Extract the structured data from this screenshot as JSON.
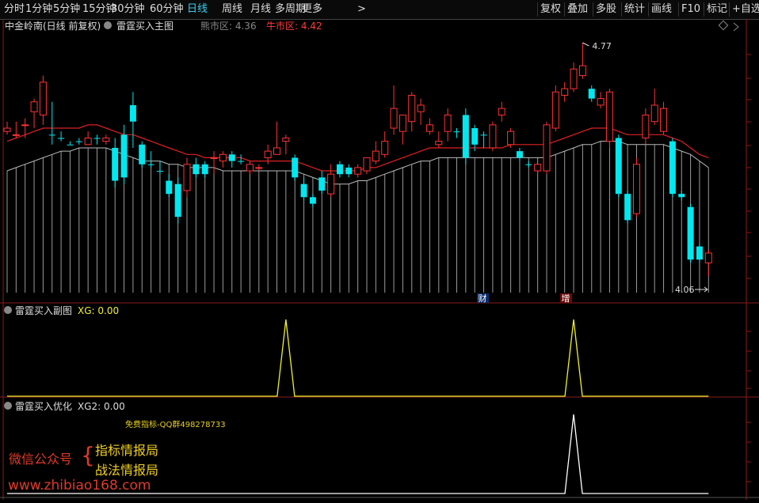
{
  "toolbar": {
    "periods": [
      "分时",
      "1分钟",
      "5分钟",
      "15分钟",
      "30分钟",
      "60分钟",
      "日线",
      "周线",
      "月线",
      "多周期",
      "更多"
    ],
    "active_period": "日线",
    "more_arrow": ">",
    "right_buttons": [
      "复权",
      "叠加",
      "多股",
      "统计",
      "画线",
      "F10",
      "标记",
      "+自选"
    ]
  },
  "main_pane": {
    "stock_title": "中金岭南(日线 前复权)",
    "indicator_name": "雷霆买入主图",
    "bear_label": "熊市区: 4.36",
    "bull_label": "牛市区: 4.42",
    "high_label": "4.77",
    "low_label": "4.06",
    "event_markers": [
      "财",
      "增"
    ]
  },
  "sub_pane1": {
    "name": "雷霆买入副图",
    "value_label": "XG: 0.00"
  },
  "sub_pane2": {
    "name": "雷霆买入优化",
    "value_label": "XG2: 0.00",
    "promo_text": "免费指标-QQ群498278733"
  },
  "watermark": {
    "account_label": "微信公众号",
    "brace": "{",
    "line1": "指标情报局",
    "line2": "战法情报局",
    "url": "www.zhibiao168.com"
  },
  "colors": {
    "up": "#ff3333",
    "down": "#00e8f0",
    "ma_red": "#e02020",
    "ma_gray": "#bbbbbb",
    "signal": "#f0f030",
    "active": "#38d0f0"
  },
  "chart_data": {
    "type": "candlestick",
    "price_high": 4.77,
    "price_low": 4.06,
    "candles": [
      {
        "o": 4.5,
        "c": 4.51,
        "h": 4.53,
        "l": 4.49,
        "up": true
      },
      {
        "o": 4.49,
        "c": 4.49,
        "h": 4.53,
        "l": 4.48,
        "up": true
      },
      {
        "o": 4.52,
        "c": 4.52,
        "h": 4.54,
        "l": 4.48,
        "up": true
      },
      {
        "o": 4.56,
        "c": 4.59,
        "h": 4.6,
        "l": 4.51,
        "up": true
      },
      {
        "o": 4.55,
        "c": 4.65,
        "h": 4.67,
        "l": 4.52,
        "up": true
      },
      {
        "o": 4.49,
        "c": 4.49,
        "h": 4.59,
        "l": 4.46,
        "up": false
      },
      {
        "o": 4.48,
        "c": 4.48,
        "h": 4.5,
        "l": 4.47,
        "up": false
      },
      {
        "o": 4.46,
        "c": 4.46,
        "h": 4.47,
        "l": 4.46,
        "up": false
      },
      {
        "o": 4.47,
        "c": 4.47,
        "h": 4.48,
        "l": 4.46,
        "up": false
      },
      {
        "o": 4.46,
        "c": 4.48,
        "h": 4.5,
        "l": 4.46,
        "up": true
      },
      {
        "o": 4.48,
        "c": 4.48,
        "h": 4.49,
        "l": 4.46,
        "up": false
      },
      {
        "o": 4.47,
        "c": 4.48,
        "h": 4.49,
        "l": 4.46,
        "up": true
      },
      {
        "o": 4.45,
        "c": 4.35,
        "h": 4.48,
        "l": 4.33,
        "up": false
      },
      {
        "o": 4.49,
        "c": 4.36,
        "h": 4.52,
        "l": 4.34,
        "up": false
      },
      {
        "o": 4.53,
        "c": 4.58,
        "h": 4.62,
        "l": 4.45,
        "up": false
      },
      {
        "o": 4.46,
        "c": 4.4,
        "h": 4.47,
        "l": 4.39,
        "up": false
      },
      {
        "o": 4.4,
        "c": 4.4,
        "h": 4.44,
        "l": 4.39,
        "up": false
      },
      {
        "o": 4.38,
        "c": 4.38,
        "h": 4.41,
        "l": 4.37,
        "up": false
      },
      {
        "o": 4.35,
        "c": 4.31,
        "h": 4.37,
        "l": 4.3,
        "up": false
      },
      {
        "o": 4.34,
        "c": 4.24,
        "h": 4.36,
        "l": 4.22,
        "up": false
      },
      {
        "o": 4.32,
        "c": 4.4,
        "h": 4.42,
        "l": 4.3,
        "up": true
      },
      {
        "o": 4.4,
        "c": 4.37,
        "h": 4.42,
        "l": 4.36,
        "up": false
      },
      {
        "o": 4.4,
        "c": 4.37,
        "h": 4.41,
        "l": 4.36,
        "up": false
      },
      {
        "o": 4.42,
        "c": 4.42,
        "h": 4.44,
        "l": 4.37,
        "up": true
      },
      {
        "o": 4.41,
        "c": 4.43,
        "h": 4.44,
        "l": 4.39,
        "up": true
      },
      {
        "o": 4.43,
        "c": 4.41,
        "h": 4.44,
        "l": 4.39,
        "up": false
      },
      {
        "o": 4.41,
        "c": 4.41,
        "h": 4.43,
        "l": 4.4,
        "up": false
      },
      {
        "o": 4.4,
        "c": 4.38,
        "h": 4.41,
        "l": 4.37,
        "up": true
      },
      {
        "o": 4.39,
        "c": 4.39,
        "h": 4.4,
        "l": 4.38,
        "up": true
      },
      {
        "o": 4.42,
        "c": 4.44,
        "h": 4.46,
        "l": 4.4,
        "up": true
      },
      {
        "o": 4.43,
        "c": 4.45,
        "h": 4.53,
        "l": 4.43,
        "up": true
      },
      {
        "o": 4.47,
        "c": 4.48,
        "h": 4.49,
        "l": 4.43,
        "up": true
      },
      {
        "o": 4.42,
        "c": 4.36,
        "h": 4.43,
        "l": 4.35,
        "up": false
      },
      {
        "o": 4.34,
        "c": 4.3,
        "h": 4.36,
        "l": 4.29,
        "up": false
      },
      {
        "o": 4.3,
        "c": 4.28,
        "h": 4.31,
        "l": 4.27,
        "up": false
      },
      {
        "o": 4.36,
        "c": 4.32,
        "h": 4.38,
        "l": 4.31,
        "up": false
      },
      {
        "o": 4.31,
        "c": 4.37,
        "h": 4.4,
        "l": 4.3,
        "up": true
      },
      {
        "o": 4.4,
        "c": 4.37,
        "h": 4.41,
        "l": 4.36,
        "up": false
      },
      {
        "o": 4.39,
        "c": 4.37,
        "h": 4.4,
        "l": 4.36,
        "up": false
      },
      {
        "o": 4.37,
        "c": 4.39,
        "h": 4.4,
        "l": 4.36,
        "up": true
      },
      {
        "o": 4.38,
        "c": 4.42,
        "h": 4.42,
        "l": 4.37,
        "up": true
      },
      {
        "o": 4.41,
        "c": 4.44,
        "h": 4.47,
        "l": 4.4,
        "up": true
      },
      {
        "o": 4.43,
        "c": 4.47,
        "h": 4.5,
        "l": 4.42,
        "up": true
      },
      {
        "o": 4.51,
        "c": 4.57,
        "h": 4.64,
        "l": 4.49,
        "up": true
      },
      {
        "o": 4.55,
        "c": 4.5,
        "h": 4.55,
        "l": 4.46,
        "up": true
      },
      {
        "o": 4.53,
        "c": 4.61,
        "h": 4.62,
        "l": 4.5,
        "up": true
      },
      {
        "o": 4.56,
        "c": 4.58,
        "h": 4.6,
        "l": 4.52,
        "up": true
      },
      {
        "o": 4.52,
        "c": 4.5,
        "h": 4.54,
        "l": 4.49,
        "up": true
      },
      {
        "o": 4.47,
        "c": 4.46,
        "h": 4.5,
        "l": 4.45,
        "up": true
      },
      {
        "o": 4.5,
        "c": 4.55,
        "h": 4.57,
        "l": 4.47,
        "up": true
      },
      {
        "o": 4.5,
        "c": 4.5,
        "h": 4.51,
        "l": 4.48,
        "up": false
      },
      {
        "o": 4.55,
        "c": 4.42,
        "h": 4.57,
        "l": 4.4,
        "up": false
      },
      {
        "o": 4.51,
        "c": 4.46,
        "h": 4.52,
        "l": 4.44,
        "up": false
      },
      {
        "o": 4.49,
        "c": 4.49,
        "h": 4.5,
        "l": 4.45,
        "up": false
      },
      {
        "o": 4.45,
        "c": 4.52,
        "h": 4.53,
        "l": 4.44,
        "up": true
      },
      {
        "o": 4.55,
        "c": 4.57,
        "h": 4.59,
        "l": 4.53,
        "up": true
      },
      {
        "o": 4.5,
        "c": 4.46,
        "h": 4.51,
        "l": 4.45,
        "up": true
      },
      {
        "o": 4.44,
        "c": 4.42,
        "h": 4.45,
        "l": 4.41,
        "up": false
      },
      {
        "o": 4.4,
        "c": 4.4,
        "h": 4.41,
        "l": 4.39,
        "up": false
      },
      {
        "o": 4.4,
        "c": 4.38,
        "h": 4.4,
        "l": 4.37,
        "up": true
      },
      {
        "o": 4.38,
        "c": 4.52,
        "h": 4.53,
        "l": 4.37,
        "up": true
      },
      {
        "o": 4.62,
        "c": 4.51,
        "h": 4.64,
        "l": 4.5,
        "up": true
      },
      {
        "o": 4.61,
        "c": 4.63,
        "h": 4.65,
        "l": 4.59,
        "up": true
      },
      {
        "o": 4.63,
        "c": 4.69,
        "h": 4.71,
        "l": 4.62,
        "up": true
      },
      {
        "o": 4.7,
        "c": 4.67,
        "h": 4.77,
        "l": 4.66,
        "up": true
      },
      {
        "o": 4.63,
        "c": 4.6,
        "h": 4.64,
        "l": 4.59,
        "up": false
      },
      {
        "o": 4.6,
        "c": 4.58,
        "h": 4.62,
        "l": 4.57,
        "up": true
      },
      {
        "o": 4.62,
        "c": 4.47,
        "h": 4.63,
        "l": 4.45,
        "up": true
      },
      {
        "o": 4.48,
        "c": 4.31,
        "h": 4.49,
        "l": 4.3,
        "up": false
      },
      {
        "o": 4.31,
        "c": 4.23,
        "h": 4.32,
        "l": 4.22,
        "up": false
      },
      {
        "o": 4.4,
        "c": 4.25,
        "h": 4.42,
        "l": 4.24,
        "up": true
      },
      {
        "o": 4.48,
        "c": 4.55,
        "h": 4.57,
        "l": 4.46,
        "up": true
      },
      {
        "o": 4.58,
        "c": 4.53,
        "h": 4.63,
        "l": 4.52,
        "up": true
      },
      {
        "o": 4.57,
        "c": 4.5,
        "h": 4.59,
        "l": 4.49,
        "up": true
      },
      {
        "o": 4.47,
        "c": 4.31,
        "h": 4.48,
        "l": 4.3,
        "up": false
      },
      {
        "o": 4.31,
        "c": 4.3,
        "h": 4.32,
        "l": 4.29,
        "up": false
      },
      {
        "o": 4.27,
        "c": 4.11,
        "h": 4.28,
        "l": 4.1,
        "up": false
      },
      {
        "o": 4.15,
        "c": 4.11,
        "h": 4.16,
        "l": 4.1,
        "up": false
      },
      {
        "o": 4.1,
        "c": 4.13,
        "h": 4.14,
        "l": 4.06,
        "up": true
      }
    ],
    "ma_red": [
      4.47,
      4.48,
      4.49,
      4.5,
      4.51,
      4.51,
      4.51,
      4.51,
      4.51,
      4.52,
      4.52,
      4.51,
      4.5,
      4.49,
      4.49,
      4.48,
      4.47,
      4.46,
      4.45,
      4.44,
      4.43,
      4.43,
      4.42,
      4.42,
      4.42,
      4.42,
      4.42,
      4.41,
      4.41,
      4.41,
      4.41,
      4.41,
      4.41,
      4.4,
      4.39,
      4.38,
      4.38,
      4.38,
      4.38,
      4.38,
      4.39,
      4.39,
      4.4,
      4.41,
      4.42,
      4.43,
      4.44,
      4.45,
      4.45,
      4.45,
      4.45,
      4.45,
      4.45,
      4.45,
      4.45,
      4.45,
      4.46,
      4.46,
      4.46,
      4.46,
      4.46,
      4.47,
      4.48,
      4.49,
      4.5,
      4.51,
      4.51,
      4.51,
      4.5,
      4.49,
      4.49,
      4.49,
      4.49,
      4.49,
      4.48,
      4.47,
      4.45,
      4.43,
      4.42
    ],
    "ma_gray": [
      4.38,
      4.39,
      4.4,
      4.41,
      4.42,
      4.43,
      4.44,
      4.44,
      4.45,
      4.45,
      4.45,
      4.45,
      4.44,
      4.43,
      4.42,
      4.41,
      4.41,
      4.41,
      4.4,
      4.4,
      4.39,
      4.39,
      4.39,
      4.39,
      4.38,
      4.38,
      4.38,
      4.38,
      4.38,
      4.38,
      4.38,
      4.38,
      4.38,
      4.37,
      4.36,
      4.35,
      4.34,
      4.34,
      4.34,
      4.35,
      4.35,
      4.36,
      4.37,
      4.38,
      4.39,
      4.4,
      4.41,
      4.41,
      4.42,
      4.42,
      4.42,
      4.42,
      4.42,
      4.42,
      4.42,
      4.42,
      4.42,
      4.42,
      4.42,
      4.42,
      4.42,
      4.43,
      4.44,
      4.45,
      4.46,
      4.46,
      4.47,
      4.47,
      4.47,
      4.46,
      4.46,
      4.46,
      4.46,
      4.46,
      4.45,
      4.44,
      4.43,
      4.41,
      4.39
    ],
    "xg_spikes": [
      31,
      63
    ],
    "xg2_spikes": [
      63
    ]
  }
}
